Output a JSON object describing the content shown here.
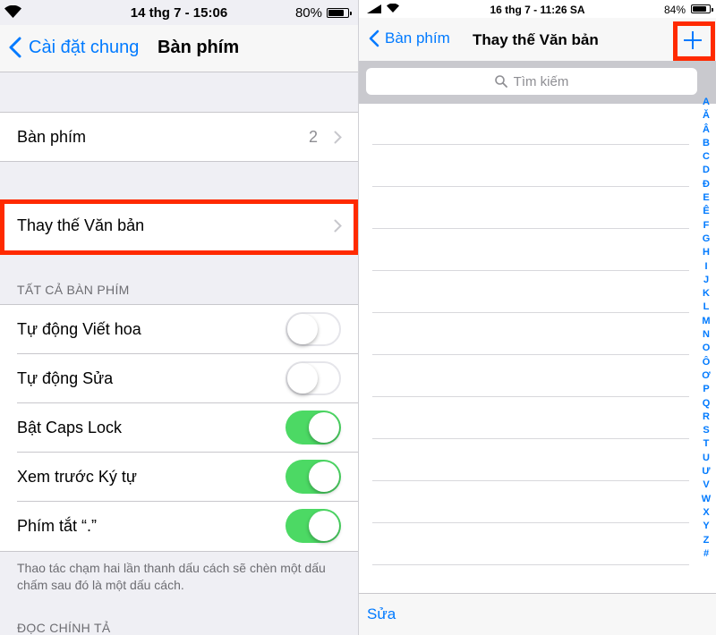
{
  "left": {
    "status": {
      "time": "14 thg 7 - 15:06",
      "battery_pct": "80%",
      "battery_level": 0.8
    },
    "nav": {
      "back_label": "Cài đặt chung",
      "title": "Bàn phím"
    },
    "keyboards": {
      "label": "Bàn phím",
      "value": "2"
    },
    "text_replacement": {
      "label": "Thay thế Văn bản"
    },
    "all_keyboards_header": "TẤT CẢ BÀN PHÍM",
    "toggles": [
      {
        "label": "Tự động Viết hoa",
        "on": false
      },
      {
        "label": "Tự động Sửa",
        "on": false
      },
      {
        "label": "Bật Caps Lock",
        "on": true
      },
      {
        "label": "Xem trước Ký tự",
        "on": true
      },
      {
        "label": "Phím tắt “.”",
        "on": true
      }
    ],
    "footer_note": "Thao tác chạm hai lần thanh dấu cách sẽ chèn một dấu chấm sau đó là một dấu cách.",
    "spelling_header": "ĐỌC CHÍNH TẢ"
  },
  "right": {
    "status": {
      "time": "16 thg 7 - 11:26 SA",
      "battery_pct": "84%",
      "battery_level": 0.84
    },
    "nav": {
      "back_label": "Bàn phím",
      "title": "Thay thế Văn bản"
    },
    "search": {
      "placeholder": "Tìm kiếm"
    },
    "index_letters": [
      "A",
      "Ă",
      "Â",
      "B",
      "C",
      "D",
      "Đ",
      "E",
      "Ê",
      "F",
      "G",
      "H",
      "I",
      "J",
      "K",
      "L",
      "M",
      "N",
      "O",
      "Ô",
      "Ơ",
      "P",
      "Q",
      "R",
      "S",
      "T",
      "U",
      "Ư",
      "V",
      "W",
      "X",
      "Y",
      "Z",
      "#"
    ],
    "toolbar": {
      "edit_label": "Sửa"
    }
  },
  "colors": {
    "ios_blue": "#007aff",
    "toggle_on": "#4cd964",
    "highlight": "#ff2a00"
  },
  "icons": {
    "wifi": "wifi-icon",
    "signal": "signal-icon",
    "back": "chevron-left-icon",
    "disclosure": "chevron-right-icon",
    "add": "plus-icon",
    "search": "search-icon"
  }
}
